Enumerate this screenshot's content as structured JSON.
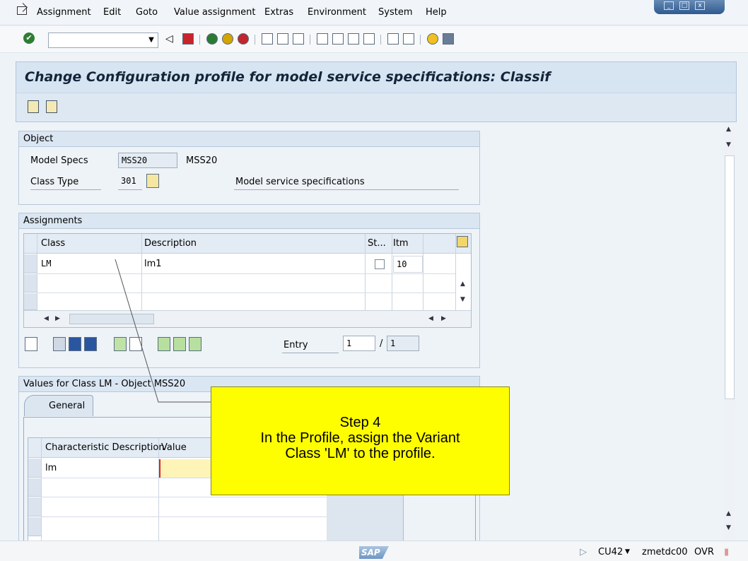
{
  "menu": {
    "items": [
      "Assignment",
      "Edit",
      "Goto",
      "Value assignment",
      "Extras",
      "Environment",
      "System",
      "Help"
    ]
  },
  "toolbar": {
    "command_value": ""
  },
  "screen": {
    "title": "Change Configuration profile for model service specifications: Classif"
  },
  "object": {
    "header": "Object",
    "model_specs_label": "Model Specs",
    "model_specs_value": "MSS20",
    "model_specs_text": "MSS20",
    "class_type_label": "Class Type",
    "class_type_value": "301",
    "class_type_text": "Model service specifications"
  },
  "assignments": {
    "header": "Assignments",
    "columns": [
      "Class",
      "Description",
      "St...",
      "Itm"
    ],
    "rows": [
      {
        "class": "LM",
        "description": "lm1",
        "itm": "10"
      }
    ],
    "entry_label": "Entry",
    "entry_value": "1",
    "entry_sep": "/",
    "entry_total": "1"
  },
  "values": {
    "header": "Values for Class LM - Object MSS20",
    "tab_label": "General",
    "columns": [
      "Characteristic Description",
      "Value"
    ],
    "rows": [
      {
        "description": "lm",
        "value": ""
      }
    ]
  },
  "callout": {
    "line1": "Step 4",
    "line2": "In the Profile, assign the Variant",
    "line3": "Class 'LM' to the profile."
  },
  "status": {
    "transaction": "CU42",
    "server": "zmetdc00",
    "mode": "OVR",
    "logo": "SAP"
  }
}
